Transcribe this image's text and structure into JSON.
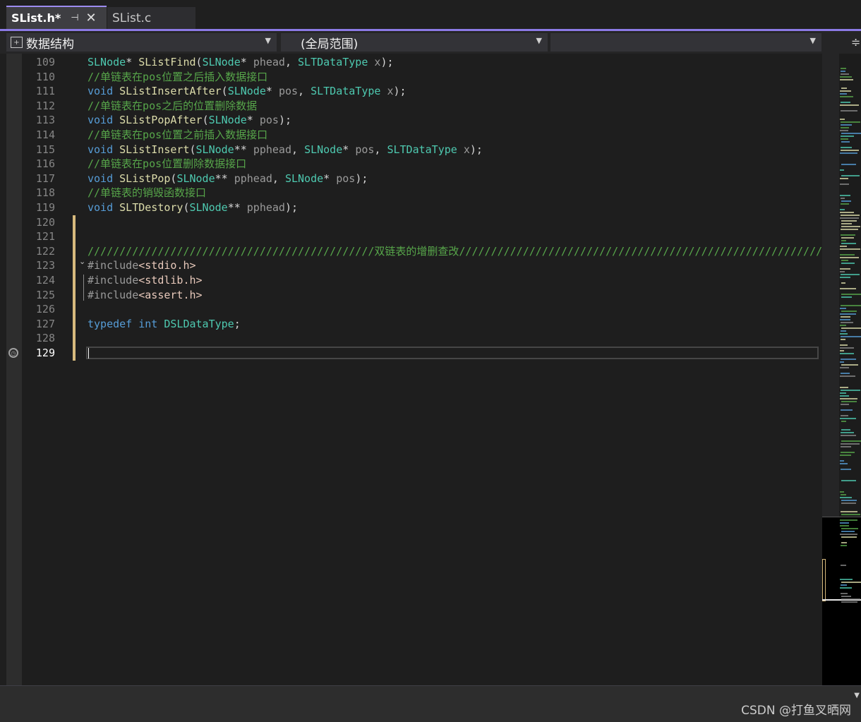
{
  "tabs": [
    {
      "label": "SList.h*",
      "active": true,
      "pin_glyph": "⊣",
      "close_glyph": "✕"
    },
    {
      "label": "SList.c",
      "active": false
    }
  ],
  "navbar": {
    "project": "数据结构",
    "scope": "(全局范围)",
    "member": ""
  },
  "editor": {
    "current_line": "129",
    "lines": [
      {
        "num": "109",
        "tokens": [
          [
            "type",
            "SLNode"
          ],
          [
            "punct",
            "* "
          ],
          [
            "func",
            "SListFind"
          ],
          [
            "punct",
            "("
          ],
          [
            "type",
            "SLNode"
          ],
          [
            "punct",
            "* "
          ],
          [
            "param",
            "phead"
          ],
          [
            "punct",
            ", "
          ],
          [
            "type",
            "SLTDataType"
          ],
          [
            "punct",
            " "
          ],
          [
            "param",
            "x"
          ],
          [
            "punct",
            ");"
          ]
        ]
      },
      {
        "num": "110",
        "tokens": [
          [
            "comment",
            "//单链表在pos位置之后插入数据接口"
          ]
        ]
      },
      {
        "num": "111",
        "tokens": [
          [
            "kw",
            "void"
          ],
          [
            "punct",
            " "
          ],
          [
            "func",
            "SListInsertAfter"
          ],
          [
            "punct",
            "("
          ],
          [
            "type",
            "SLNode"
          ],
          [
            "punct",
            "* "
          ],
          [
            "param",
            "pos"
          ],
          [
            "punct",
            ", "
          ],
          [
            "type",
            "SLTDataType"
          ],
          [
            "punct",
            " "
          ],
          [
            "param",
            "x"
          ],
          [
            "punct",
            ");"
          ]
        ]
      },
      {
        "num": "112",
        "tokens": [
          [
            "comment",
            "//单链表在pos之后的位置删除数据"
          ]
        ]
      },
      {
        "num": "113",
        "tokens": [
          [
            "kw",
            "void"
          ],
          [
            "punct",
            " "
          ],
          [
            "func",
            "SListPopAfter"
          ],
          [
            "punct",
            "("
          ],
          [
            "type",
            "SLNode"
          ],
          [
            "punct",
            "* "
          ],
          [
            "param",
            "pos"
          ],
          [
            "punct",
            ");"
          ]
        ]
      },
      {
        "num": "114",
        "tokens": [
          [
            "comment",
            "//单链表在pos位置之前插入数据接口"
          ]
        ]
      },
      {
        "num": "115",
        "tokens": [
          [
            "kw",
            "void"
          ],
          [
            "punct",
            " "
          ],
          [
            "func",
            "SListInsert"
          ],
          [
            "punct",
            "("
          ],
          [
            "type",
            "SLNode"
          ],
          [
            "punct",
            "** "
          ],
          [
            "param",
            "pphead"
          ],
          [
            "punct",
            ", "
          ],
          [
            "type",
            "SLNode"
          ],
          [
            "punct",
            "* "
          ],
          [
            "param",
            "pos"
          ],
          [
            "punct",
            ", "
          ],
          [
            "type",
            "SLTDataType"
          ],
          [
            "punct",
            " "
          ],
          [
            "param",
            "x"
          ],
          [
            "punct",
            ");"
          ]
        ]
      },
      {
        "num": "116",
        "tokens": [
          [
            "comment",
            "//单链表在pos位置删除数据接口"
          ]
        ]
      },
      {
        "num": "117",
        "tokens": [
          [
            "kw",
            "void"
          ],
          [
            "punct",
            " "
          ],
          [
            "func",
            "SListPop"
          ],
          [
            "punct",
            "("
          ],
          [
            "type",
            "SLNode"
          ],
          [
            "punct",
            "** "
          ],
          [
            "param",
            "pphead"
          ],
          [
            "punct",
            ", "
          ],
          [
            "type",
            "SLNode"
          ],
          [
            "punct",
            "* "
          ],
          [
            "param",
            "pos"
          ],
          [
            "punct",
            ");"
          ]
        ]
      },
      {
        "num": "118",
        "tokens": [
          [
            "comment",
            "//单链表的销毁函数接口"
          ]
        ]
      },
      {
        "num": "119",
        "tokens": [
          [
            "kw",
            "void"
          ],
          [
            "punct",
            " "
          ],
          [
            "func",
            "SLTDestory"
          ],
          [
            "punct",
            "("
          ],
          [
            "type",
            "SLNode"
          ],
          [
            "punct",
            "** "
          ],
          [
            "param",
            "pphead"
          ],
          [
            "punct",
            ");"
          ]
        ]
      },
      {
        "num": "120",
        "tokens": []
      },
      {
        "num": "121",
        "tokens": []
      },
      {
        "num": "122",
        "tokens": [
          [
            "comment",
            "/////////////////////////////////////////////双链表的增删查改/////////////////////////////////////////////////////////"
          ]
        ]
      },
      {
        "num": "123",
        "tokens": [
          [
            "inc",
            "#include"
          ],
          [
            "str",
            "<stdio.h>"
          ]
        ]
      },
      {
        "num": "124",
        "tokens": [
          [
            "inc",
            "#include"
          ],
          [
            "str",
            "<stdlib.h>"
          ]
        ]
      },
      {
        "num": "125",
        "tokens": [
          [
            "inc",
            "#include"
          ],
          [
            "str",
            "<assert.h>"
          ]
        ]
      },
      {
        "num": "126",
        "tokens": []
      },
      {
        "num": "127",
        "tokens": [
          [
            "kw",
            "typedef"
          ],
          [
            "punct",
            " "
          ],
          [
            "kw",
            "int"
          ],
          [
            "punct",
            " "
          ],
          [
            "type",
            "DSLDataType"
          ],
          [
            "punct",
            ";"
          ]
        ]
      },
      {
        "num": "128",
        "tokens": []
      },
      {
        "num": "129",
        "tokens": []
      }
    ]
  },
  "colors": {
    "accent": "#8c7ae6",
    "type": "#4ec9b0",
    "function": "#dcdcaa",
    "keyword": "#569cd6",
    "comment": "#57a64a",
    "string": "#e8c9bb",
    "change_marker": "#d7ba7d"
  },
  "icons": {
    "project": "project-icon",
    "pin": "pin-icon",
    "close": "close-icon",
    "breakpoint": "history-clock-icon",
    "fold": "chevron-down-icon",
    "split": "split-editor-icon"
  },
  "watermark": "CSDN @打鱼叉晒网"
}
